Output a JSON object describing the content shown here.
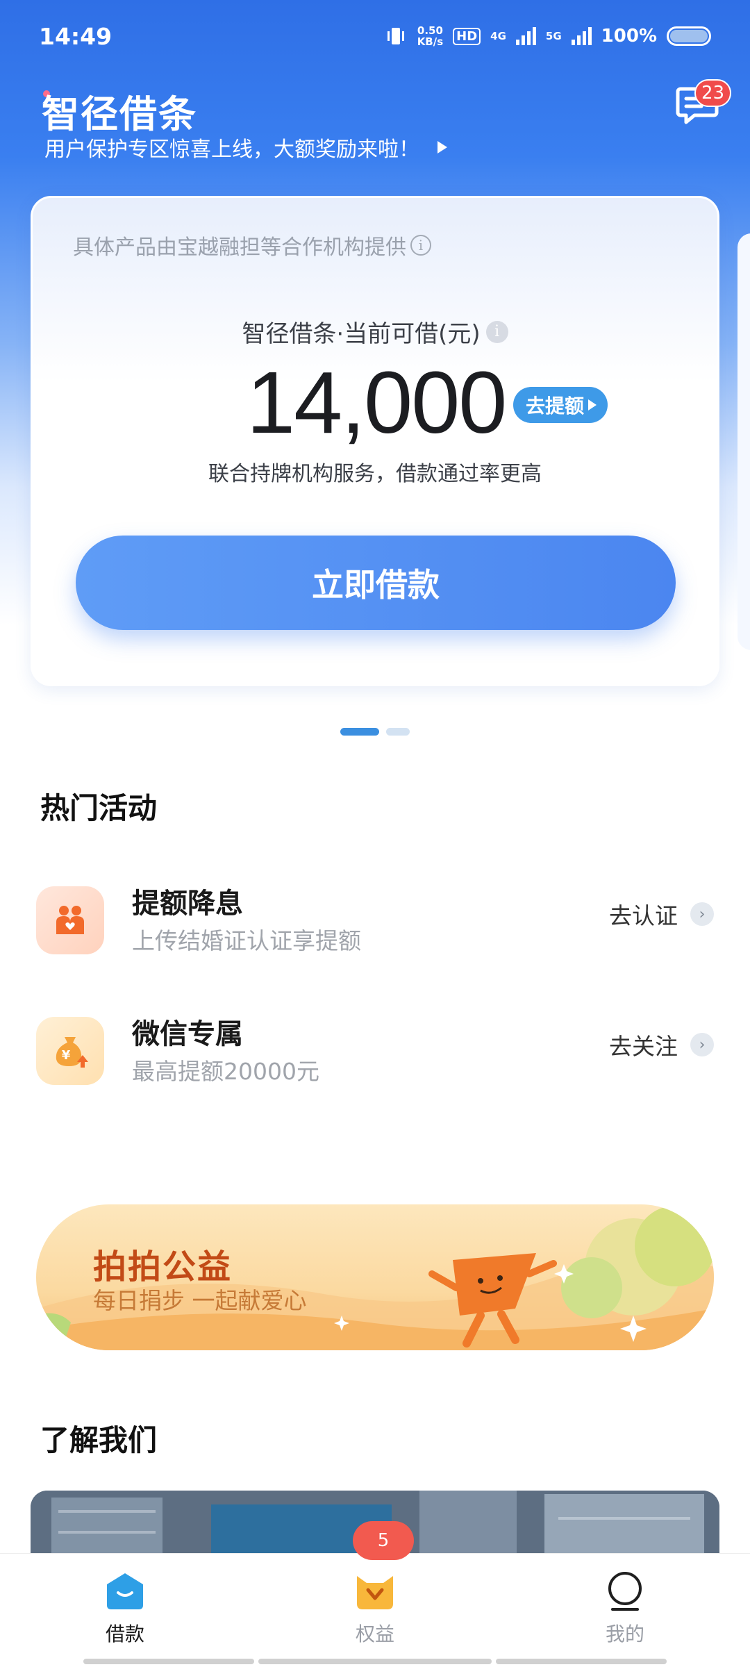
{
  "status_bar": {
    "time": "14:49",
    "net_speed": "0.50",
    "net_unit": "KB/s",
    "hd": "HD",
    "net_4g": "4G",
    "net_5g": "5G",
    "battery": "100%"
  },
  "header": {
    "title": "智径借条",
    "promo": "用户保护专区惊喜上线，大额奖励来啦！",
    "message_badge": "23"
  },
  "card": {
    "provider": "具体产品由宝越融担等合作机构提供",
    "available_label": "智径借条·当前可借(元)",
    "amount": "14,000",
    "raise_label": "去提额",
    "subtitle": "联合持牌机构服务，借款通过率更高",
    "borrow_label": "立即借款"
  },
  "hot": {
    "title": "热门活动",
    "items": [
      {
        "title": "提额降息",
        "subtitle": "上传结婚证认证享提额",
        "action": "去认证"
      },
      {
        "title": "微信专属",
        "subtitle": "最高提额20000元",
        "action": "去关注"
      }
    ]
  },
  "banner": {
    "title": "拍拍公益",
    "subtitle": "每日捐步 一起献爱心"
  },
  "about": {
    "title": "了解我们"
  },
  "nav": {
    "items": [
      {
        "label": "借款",
        "icon": "home-bag-icon"
      },
      {
        "label": "权益",
        "icon": "rights-icon"
      },
      {
        "label": "我的",
        "icon": "profile-icon"
      }
    ],
    "badge": "5"
  },
  "colors": {
    "accent": "#4b86f0",
    "raise": "#3e9ae8",
    "badge": "#f04b4b",
    "banner_title": "#c24a16"
  }
}
